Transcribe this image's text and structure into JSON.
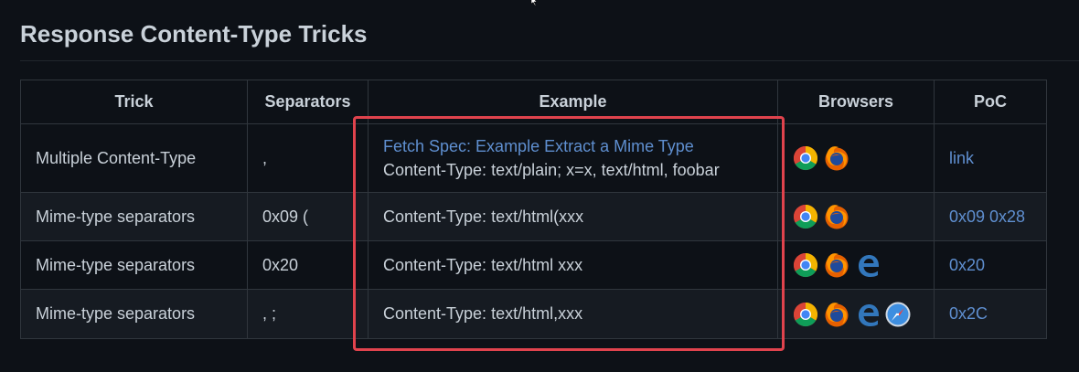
{
  "heading": "Response Content-Type Tricks",
  "table": {
    "headers": [
      "Trick",
      "Separators",
      "Example",
      "Browsers",
      "PoC"
    ],
    "rows": [
      {
        "trick": "Multiple Content-Type",
        "separators": ",",
        "example_link": "Fetch Spec: Example Extract a Mime Type",
        "example": "Content-Type: text/plain; x=x, text/html, foobar",
        "browsers": [
          "chrome",
          "firefox"
        ],
        "poc": "link"
      },
      {
        "trick": "Mime-type separators",
        "separators": "0x09 (",
        "example": "Content-Type: text/html(xxx",
        "browsers": [
          "chrome",
          "firefox"
        ],
        "poc": "0x09 0x28"
      },
      {
        "trick": "Mime-type separators",
        "separators": "0x20",
        "example": "Content-Type: text/html xxx",
        "browsers": [
          "chrome",
          "firefox",
          "edge"
        ],
        "poc": "0x20"
      },
      {
        "trick": "Mime-type separators",
        "separators": ", ;",
        "example": "Content-Type: text/html,xxx",
        "browsers": [
          "chrome",
          "firefox",
          "edge",
          "safari"
        ],
        "poc": "0x2C"
      }
    ]
  },
  "icons": {
    "chrome": "chrome-icon",
    "firefox": "firefox-icon",
    "edge": "edge-icon",
    "safari": "safari-icon"
  },
  "colors": {
    "background": "#0d1117",
    "alt_row": "#161b22",
    "link": "#5f8fd0",
    "highlight": "#e0434d"
  }
}
